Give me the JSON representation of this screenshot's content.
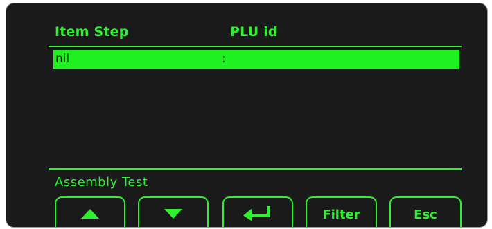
{
  "table": {
    "headers": {
      "item_step": "Item Step",
      "plu_id": "PLU id"
    },
    "rows": [
      {
        "item_step": "nil",
        "plu_id": ":"
      }
    ]
  },
  "status_text": "Assembly Test",
  "buttons": {
    "up": {
      "icon": "arrow-up-icon"
    },
    "down": {
      "icon": "arrow-down-icon"
    },
    "enter": {
      "icon": "enter-return-icon"
    },
    "filter": {
      "label": "Filter"
    },
    "esc": {
      "label": "Esc"
    }
  },
  "colors": {
    "background": "#1a1a1a",
    "accent": "#2ef02e",
    "selected_row": "#1ff01f"
  }
}
